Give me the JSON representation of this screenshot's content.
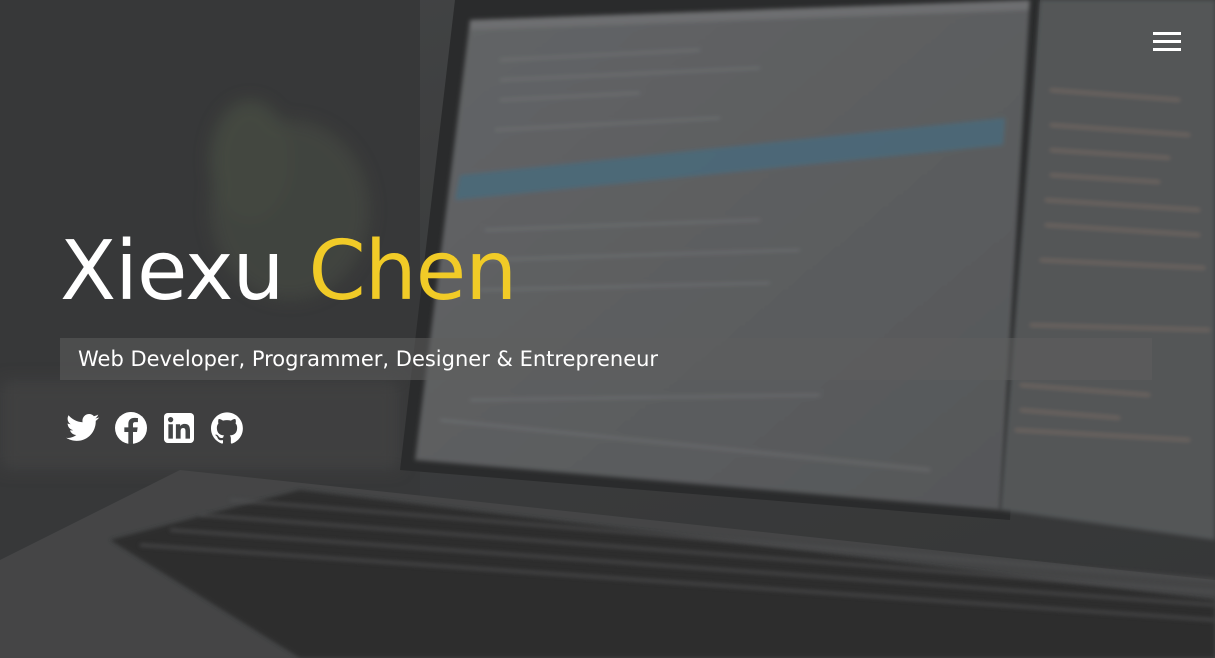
{
  "hero": {
    "first_name": "Xiexu",
    "last_name": "Chen",
    "tagline": "Web Developer, Programmer, Designer & Entrepreneur"
  },
  "nav": {
    "menu_icon": "hamburger-menu-icon"
  },
  "socials": [
    {
      "name": "twitter",
      "icon": "twitter-icon"
    },
    {
      "name": "facebook",
      "icon": "facebook-icon"
    },
    {
      "name": "linkedin",
      "icon": "linkedin-icon"
    },
    {
      "name": "github",
      "icon": "github-icon"
    }
  ],
  "colors": {
    "accent": "#f1cb27",
    "text": "#ffffff",
    "background": "#3b3d3e"
  }
}
